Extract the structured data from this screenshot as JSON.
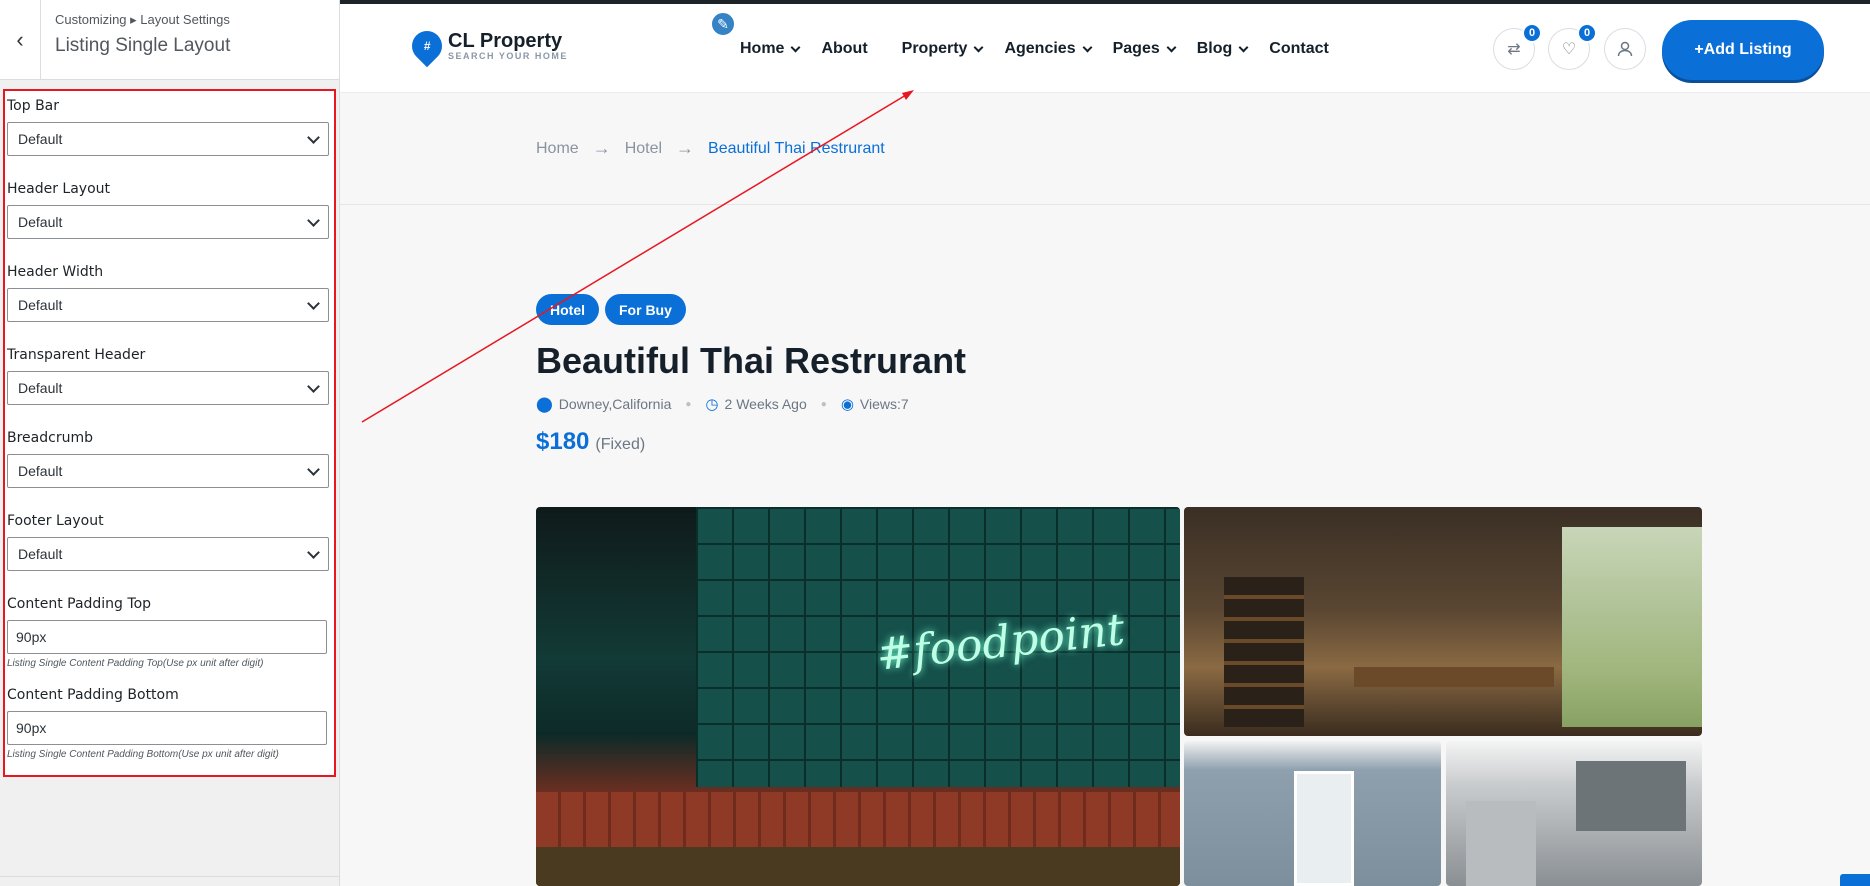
{
  "customizer": {
    "breadcrumb": "Customizing ▸ Layout Settings",
    "title": "Listing Single Layout",
    "controls": [
      {
        "label": "Top Bar",
        "value": "Default"
      },
      {
        "label": "Header Layout",
        "value": "Default"
      },
      {
        "label": "Header Width",
        "value": "Default"
      },
      {
        "label": "Transparent Header",
        "value": "Default"
      },
      {
        "label": "Breadcrumb",
        "value": "Default"
      },
      {
        "label": "Footer Layout",
        "value": "Default"
      }
    ],
    "padding_top": {
      "label": "Content Padding Top",
      "value": "90px",
      "description": "Listing Single Content Padding Top(Use px unit after digit)"
    },
    "padding_bottom": {
      "label": "Content Padding Bottom",
      "value": "90px",
      "description": "Listing Single Content Padding Bottom(Use px unit after digit)"
    }
  },
  "site": {
    "logo_name": "CL Property",
    "logo_tagline": "SEARCH YOUR HOME",
    "nav": [
      {
        "label": "Home",
        "dropdown": true
      },
      {
        "label": "About",
        "dropdown": false
      },
      {
        "label": "Property",
        "dropdown": true
      },
      {
        "label": "Agencies",
        "dropdown": true
      },
      {
        "label": "Pages",
        "dropdown": true
      },
      {
        "label": "Blog",
        "dropdown": true
      },
      {
        "label": "Contact",
        "dropdown": false
      }
    ],
    "compare_count": "0",
    "wishlist_count": "0",
    "add_listing": "+Add Listing"
  },
  "breadcrumb": [
    "Home",
    "Hotel",
    "Beautiful Thai Restrurant"
  ],
  "listing": {
    "tags": [
      "Hotel",
      "For Buy"
    ],
    "title": "Beautiful Thai Restrurant",
    "location": "Downey,California",
    "posted": "2 Weeks Ago",
    "views": "Views:7",
    "price": "$180",
    "price_type": "(Fixed)"
  },
  "colors": {
    "accent": "#0b6fd8",
    "annotation": "#e8161f"
  }
}
